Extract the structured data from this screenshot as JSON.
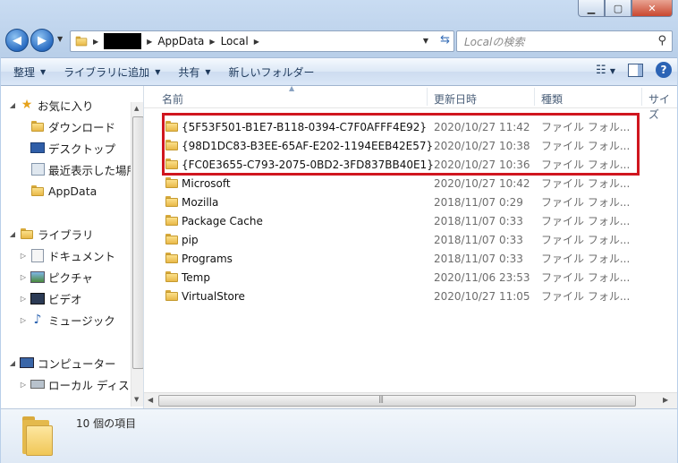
{
  "address": {
    "crumbs": [
      "AppData",
      "Local"
    ]
  },
  "search": {
    "placeholder": "Localの検索"
  },
  "toolbar": {
    "organize": "整理",
    "include_in_library": "ライブラリに追加",
    "share": "共有",
    "new_folder": "新しいフォルダー"
  },
  "nav": {
    "favorites": "お気に入り",
    "downloads": "ダウンロード",
    "desktop": "デスクトップ",
    "recent": "最近表示した場所",
    "appdata": "AppData",
    "libraries": "ライブラリ",
    "documents": "ドキュメント",
    "pictures": "ピクチャ",
    "videos": "ビデオ",
    "music": "ミュージック",
    "computer": "コンピューター",
    "local_disk": "ローカル ディスク"
  },
  "columns": {
    "name": "名前",
    "date": "更新日時",
    "type": "種類",
    "size": "サイズ"
  },
  "files": [
    {
      "name": "{5F53F501-B1E7-B118-0394-C7F0AFFF4E92}",
      "date": "2020/10/27 11:42",
      "type": "ファイル フォル..."
    },
    {
      "name": "{98D1DC83-B3EE-65AF-E202-1194EEB42E57}",
      "date": "2020/10/27 10:38",
      "type": "ファイル フォル..."
    },
    {
      "name": "{FC0E3655-C793-2075-0BD2-3FD837BB40E1}",
      "date": "2020/10/27 10:36",
      "type": "ファイル フォル..."
    },
    {
      "name": "Microsoft",
      "date": "2020/10/27 10:42",
      "type": "ファイル フォル..."
    },
    {
      "name": "Mozilla",
      "date": "2018/11/07 0:29",
      "type": "ファイル フォル..."
    },
    {
      "name": "Package Cache",
      "date": "2018/11/07 0:33",
      "type": "ファイル フォル..."
    },
    {
      "name": "pip",
      "date": "2018/11/07 0:33",
      "type": "ファイル フォル..."
    },
    {
      "name": "Programs",
      "date": "2018/11/07 0:33",
      "type": "ファイル フォル..."
    },
    {
      "name": "Temp",
      "date": "2020/11/06 23:53",
      "type": "ファイル フォル..."
    },
    {
      "name": "VirtualStore",
      "date": "2020/10/27 11:05",
      "type": "ファイル フォル..."
    }
  ],
  "details": {
    "item_count": "10 個の項目"
  },
  "colors": {
    "highlight": "#d0161f",
    "accent": "#2b63b5"
  }
}
